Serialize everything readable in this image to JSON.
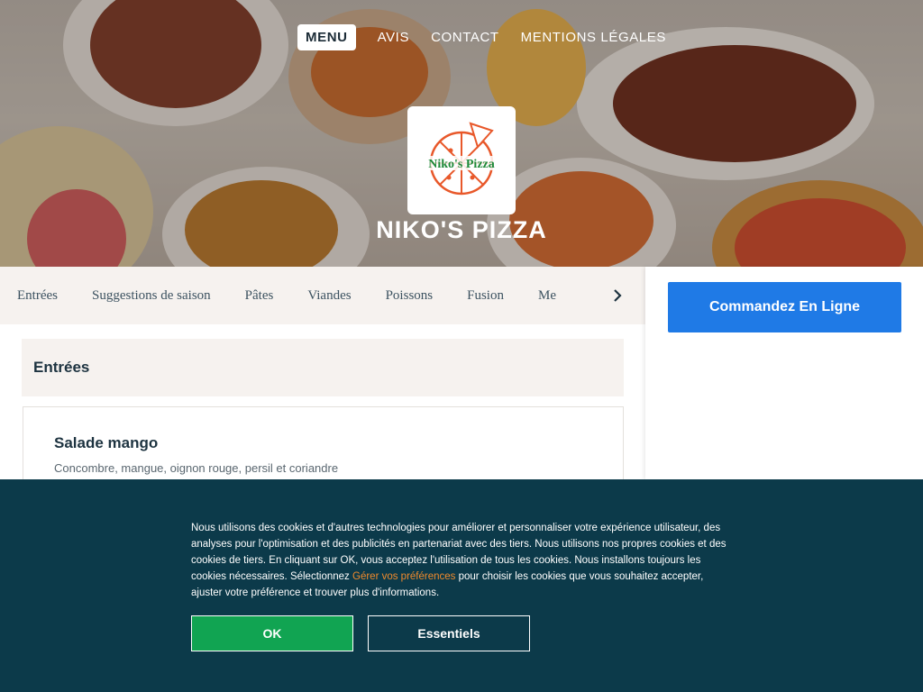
{
  "nav": {
    "items": [
      "MENU",
      "AVIS",
      "CONTACT",
      "MENTIONS LÉGALES"
    ],
    "active_index": 0
  },
  "brand": {
    "logo_text": "Niko's Pizza",
    "title": "NIKO'S PIZZA"
  },
  "categories": {
    "items": [
      "Entrées",
      "Suggestions de saison",
      "Pâtes",
      "Viandes",
      "Poissons",
      "Fusion",
      "Me"
    ],
    "scroll_icon": "chevron-right-icon"
  },
  "menu": {
    "section_title": "Entrées",
    "item": {
      "name": "Salade mango",
      "description": "Concombre, mangue, oignon rouge, persil et coriandre"
    }
  },
  "sidebar": {
    "order_label": "Commandez En Ligne"
  },
  "cookie": {
    "text_before": "Nous utilisons des cookies et d'autres technologies pour améliorer et personnaliser votre expérience utilisateur, des analyses pour l'optimisation et des publicités en partenariat avec des tiers. Nous utilisons nos propres cookies et des cookies de tiers. En cliquant sur OK, vous acceptez l'utilisation de tous les cookies. Nous installons toujours les cookies nécessaires. Sélectionnez ",
    "link_text": "Gérer vos préférences",
    "text_after": " pour choisir les cookies que vous souhaitez accepter, ajuster votre préférence et trouver plus d'informations.",
    "ok_label": "OK",
    "essentials_label": "Essentiels"
  },
  "colors": {
    "order_button": "#1f7ae6",
    "cookie_bg": "#0c3a4a",
    "ok_button": "#11a452",
    "link": "#f08a2c",
    "logo_orange": "#e8582a",
    "logo_green": "#1f8a3a"
  }
}
